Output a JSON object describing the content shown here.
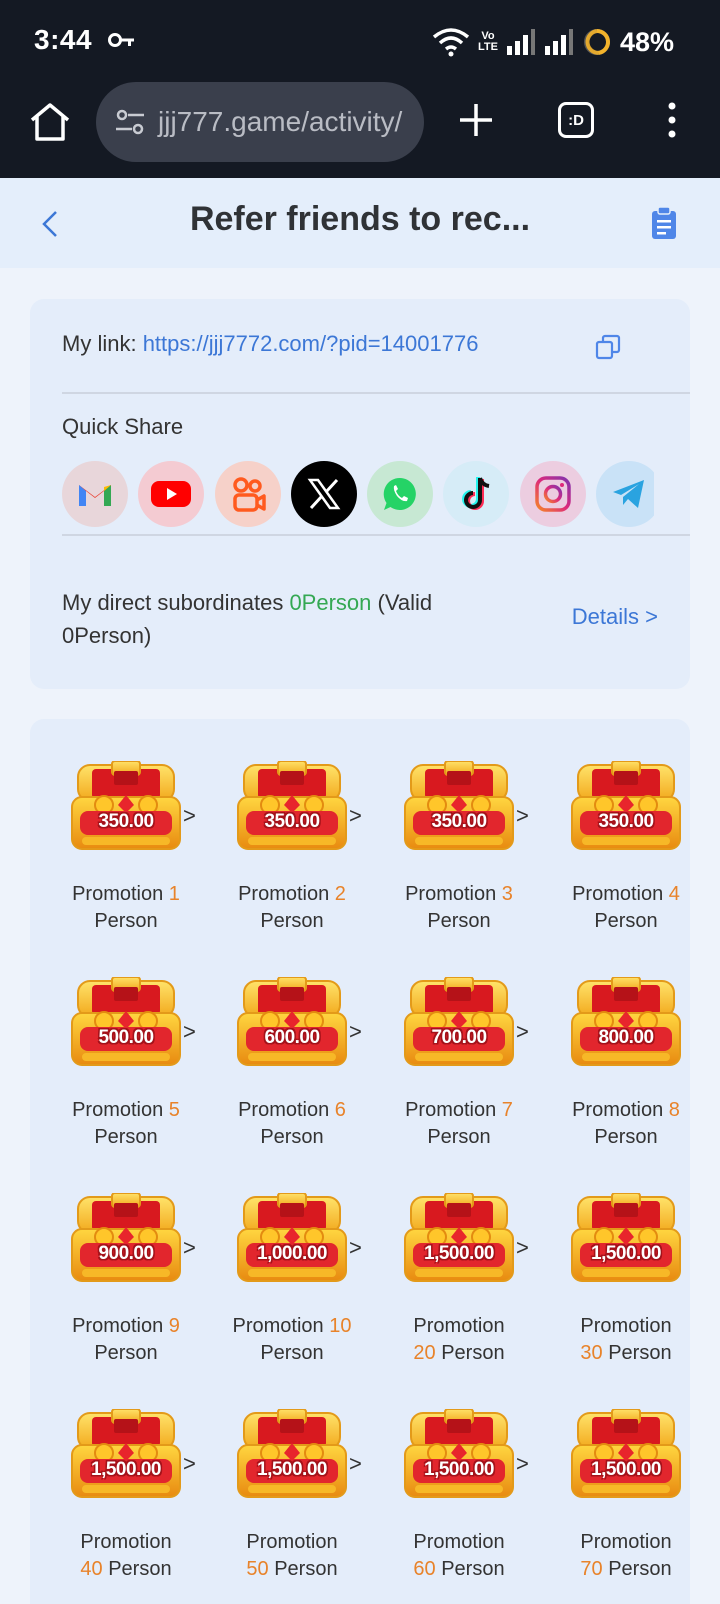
{
  "status_bar": {
    "time": "3:44",
    "network_label_top": "Vo",
    "network_label_bottom": "LTE",
    "battery": "48%"
  },
  "browser": {
    "url": "jjj777.game/activity/",
    "tab_label": ":D"
  },
  "header": {
    "title": "Refer friends to rec..."
  },
  "link_card": {
    "my_link_label": "My link:",
    "my_link_url": "https://jjj7772.com/?pid=14001776",
    "quick_share_label": "Quick Share",
    "share_targets": [
      "gmail",
      "youtube",
      "kuaishou",
      "x",
      "whatsapp",
      "tiktok",
      "instagram",
      "telegram"
    ],
    "subs_prefix": "My direct subordinates ",
    "subs_count": "0Person",
    "subs_suffix": " (Valid 0Person)",
    "details_label": "Details >"
  },
  "rewards": [
    {
      "amount": "350.00",
      "label": "Promotion",
      "count": "1",
      "unit": "Person"
    },
    {
      "amount": "350.00",
      "label": "Promotion",
      "count": "2",
      "unit": "Person"
    },
    {
      "amount": "350.00",
      "label": "Promotion",
      "count": "3",
      "unit": "Person"
    },
    {
      "amount": "350.00",
      "label": "Promotion",
      "count": "4",
      "unit": "Person"
    },
    {
      "amount": "500.00",
      "label": "Promotion",
      "count": "5",
      "unit": "Person"
    },
    {
      "amount": "600.00",
      "label": "Promotion",
      "count": "6",
      "unit": "Person"
    },
    {
      "amount": "700.00",
      "label": "Promotion",
      "count": "7",
      "unit": "Person"
    },
    {
      "amount": "800.00",
      "label": "Promotion",
      "count": "8",
      "unit": "Person"
    },
    {
      "amount": "900.00",
      "label": "Promotion",
      "count": "9",
      "unit": "Person"
    },
    {
      "amount": "1,000.00",
      "label": "Promotion",
      "count": "10",
      "unit": "Person"
    },
    {
      "amount": "1,500.00",
      "label": "Promotion",
      "count": "20",
      "unit": "Person"
    },
    {
      "amount": "1,500.00",
      "label": "Promotion",
      "count": "30",
      "unit": "Person"
    },
    {
      "amount": "1,500.00",
      "label": "Promotion",
      "count": "40",
      "unit": "Person"
    },
    {
      "amount": "1,500.00",
      "label": "Promotion",
      "count": "50",
      "unit": "Person"
    },
    {
      "amount": "1,500.00",
      "label": "Promotion",
      "count": "60",
      "unit": "Person"
    },
    {
      "amount": "1,500.00",
      "label": "Promotion",
      "count": "70",
      "unit": "Person"
    }
  ],
  "arrow_glyph": ">",
  "colors": {
    "accent_blue": "#3c77d6",
    "green": "#34a853",
    "orange": "#e8832a",
    "dark_bar": "#141923"
  }
}
